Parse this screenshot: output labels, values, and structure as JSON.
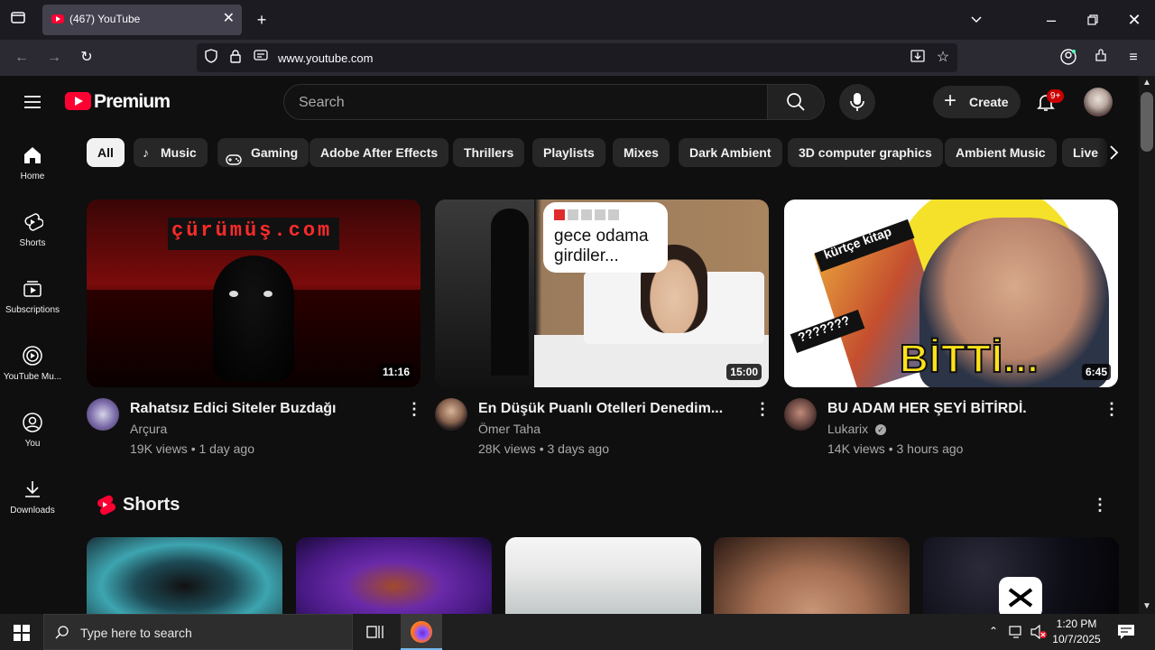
{
  "browser": {
    "tab_title": "(467) YouTube",
    "url": "www.youtube.com"
  },
  "header": {
    "logo_text": "Premium",
    "search_placeholder": "Search",
    "create_label": "Create",
    "notifications_badge": "9+"
  },
  "sidebar": {
    "items": [
      {
        "label": "Home",
        "icon": "home-icon"
      },
      {
        "label": "Shorts",
        "icon": "shorts-icon"
      },
      {
        "label": "Subscriptions",
        "icon": "subscriptions-icon"
      },
      {
        "label": "YouTube Mu...",
        "icon": "youtube-music-icon"
      },
      {
        "label": "You",
        "icon": "user-icon"
      },
      {
        "label": "Downloads",
        "icon": "download-icon"
      }
    ]
  },
  "chips": [
    "All",
    "Music",
    "Gaming",
    "Adobe After Effects",
    "Thrillers",
    "Playlists",
    "Mixes",
    "Dark Ambient",
    "3D computer graphics",
    "Ambient Music",
    "Live"
  ],
  "videos": [
    {
      "title": "Rahatsız Edici Siteler Buzdağı",
      "channel": "Arçura",
      "meta": "19K views • 1 day ago",
      "duration": "11:16",
      "thumb_text": "çürümüş.com"
    },
    {
      "title": "En Düşük Puanlı Otelleri Denedim...",
      "channel": "Ömer Taha",
      "meta": "28K views • 3 days ago",
      "duration": "15:00",
      "thumb_text": "gece odama girdiler..."
    },
    {
      "title": "BU ADAM HER ŞEYİ BİTİRDİ.",
      "channel": "Lukarix",
      "meta": "14K views • 3 hours ago",
      "duration": "6:45",
      "thumb_text": "BİTTİ...",
      "thumb_text2": "kürtçe kitap",
      "thumb_text3": "???????"
    }
  ],
  "shorts": {
    "heading": "Shorts"
  },
  "taskbar": {
    "search_placeholder": "Type here to search",
    "time": "1:20 PM",
    "date": "10/7/2025"
  },
  "colors": {
    "yt_red": "#ff0033",
    "background": "#0f0f0f",
    "chip_bg": "#272727"
  }
}
